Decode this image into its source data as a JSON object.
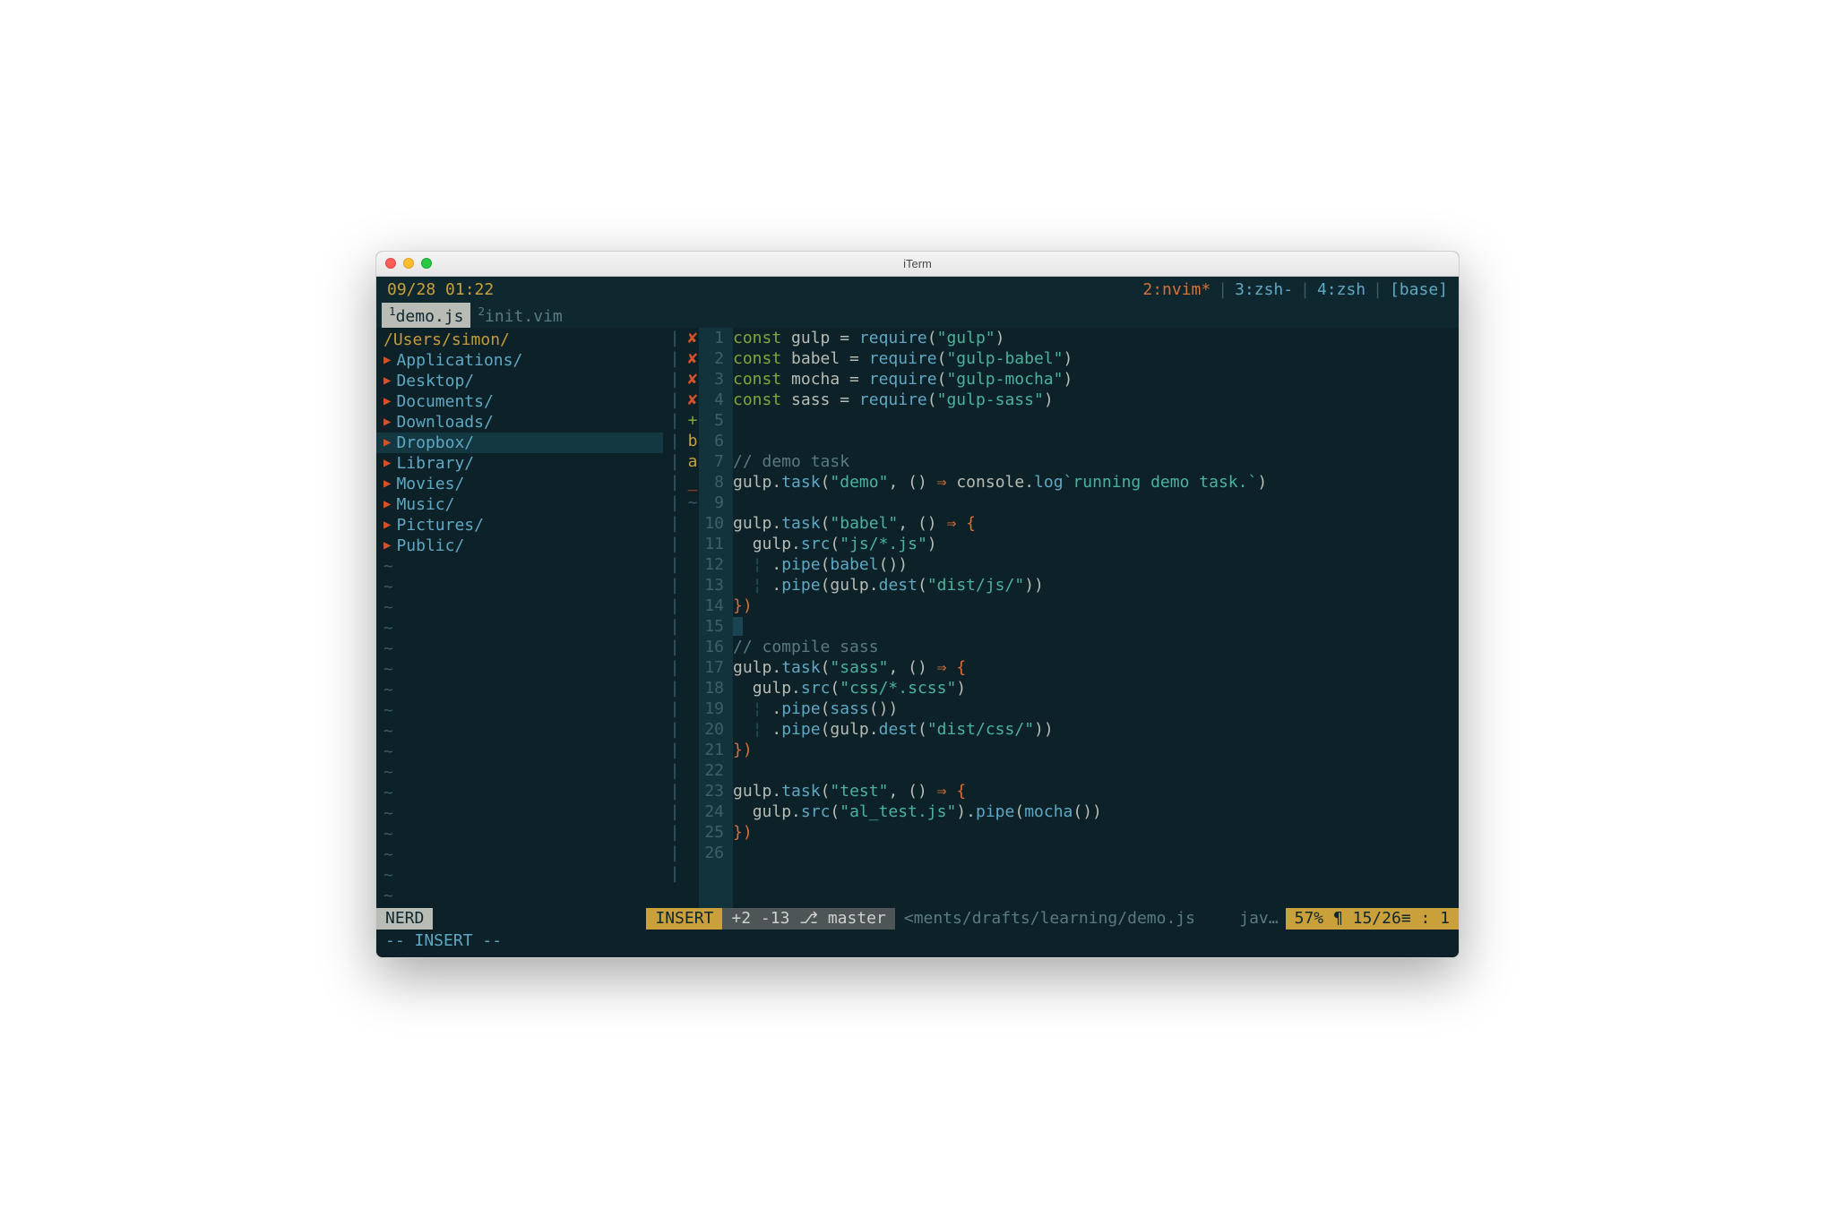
{
  "window": {
    "title": "iTerm"
  },
  "topbar": {
    "time": "09/28 01:22",
    "tabs": {
      "nvim": "2:nvim*",
      "zsh3": "3:zsh-",
      "zsh4": "4:zsh",
      "base": "[base]"
    }
  },
  "tabbar": {
    "active": {
      "num": "1",
      "name": "demo.js"
    },
    "inactive": {
      "num": "2",
      "name": "init.vim"
    }
  },
  "tree": {
    "path": "/Users/simon/",
    "items": [
      "Applications/",
      "Desktop/",
      "Documents/",
      "Downloads/",
      "Dropbox/",
      "Library/",
      "Movies/",
      "Music/",
      "Pictures/",
      "Public/"
    ],
    "selected_index": 4,
    "tildes": 17
  },
  "signs": [
    "✘",
    "✘",
    "✘",
    "✘",
    "",
    "",
    "+",
    "",
    "b",
    "",
    "",
    "",
    "",
    "",
    "",
    "a",
    "",
    "",
    "",
    "",
    "",
    "",
    "",
    "",
    "",
    "_"
  ],
  "linenums": 26,
  "code": [
    [
      [
        "kw",
        "const "
      ],
      [
        "ident",
        "gulp"
      ],
      [
        "op",
        " = "
      ],
      [
        "func",
        "require"
      ],
      [
        "paren",
        "("
      ],
      [
        "str",
        "\"gulp\""
      ],
      [
        "paren",
        ")"
      ]
    ],
    [
      [
        "kw",
        "const "
      ],
      [
        "ident",
        "babel"
      ],
      [
        "op",
        " = "
      ],
      [
        "func",
        "require"
      ],
      [
        "paren",
        "("
      ],
      [
        "str",
        "\"gulp-babel\""
      ],
      [
        "paren",
        ")"
      ]
    ],
    [
      [
        "kw",
        "const "
      ],
      [
        "ident",
        "mocha"
      ],
      [
        "op",
        " = "
      ],
      [
        "func",
        "require"
      ],
      [
        "paren",
        "("
      ],
      [
        "str",
        "\"gulp-mocha\""
      ],
      [
        "paren",
        ")"
      ]
    ],
    [
      [
        "kw",
        "const "
      ],
      [
        "ident",
        "sass"
      ],
      [
        "op",
        " = "
      ],
      [
        "func",
        "require"
      ],
      [
        "paren",
        "("
      ],
      [
        "str",
        "\"gulp-sass\""
      ],
      [
        "paren",
        ")"
      ]
    ],
    [],
    [],
    [
      [
        "comment",
        "// demo task"
      ]
    ],
    [
      [
        "ident",
        "gulp"
      ],
      [
        "dot",
        "."
      ],
      [
        "prop",
        "task"
      ],
      [
        "paren",
        "("
      ],
      [
        "str",
        "\"demo\""
      ],
      [
        "op",
        ", "
      ],
      [
        "paren",
        "()"
      ],
      [
        "op",
        " "
      ],
      [
        "arrow",
        "⇒"
      ],
      [
        "op",
        " "
      ],
      [
        "ident",
        "console"
      ],
      [
        "dot",
        "."
      ],
      [
        "prop",
        "log"
      ],
      [
        "tmpl",
        "`running demo task.`"
      ],
      [
        "paren",
        ")"
      ]
    ],
    [],
    [
      [
        "ident",
        "gulp"
      ],
      [
        "dot",
        "."
      ],
      [
        "prop",
        "task"
      ],
      [
        "paren",
        "("
      ],
      [
        "str",
        "\"babel\""
      ],
      [
        "op",
        ", "
      ],
      [
        "paren",
        "()"
      ],
      [
        "op",
        " "
      ],
      [
        "arrow",
        "⇒"
      ],
      [
        "op",
        " "
      ],
      [
        "brace",
        "{"
      ]
    ],
    [
      [
        "op",
        "  "
      ],
      [
        "ident",
        "gulp"
      ],
      [
        "dot",
        "."
      ],
      [
        "prop",
        "src"
      ],
      [
        "paren",
        "("
      ],
      [
        "str",
        "\"js/*.js\""
      ],
      [
        "paren",
        ")"
      ]
    ],
    [
      [
        "op",
        "  "
      ],
      [
        "guide",
        "¦ "
      ],
      [
        "dot",
        "."
      ],
      [
        "prop",
        "pipe"
      ],
      [
        "paren",
        "("
      ],
      [
        "func",
        "babel"
      ],
      [
        "paren",
        "())"
      ]
    ],
    [
      [
        "op",
        "  "
      ],
      [
        "guide",
        "¦ "
      ],
      [
        "dot",
        "."
      ],
      [
        "prop",
        "pipe"
      ],
      [
        "paren",
        "("
      ],
      [
        "ident",
        "gulp"
      ],
      [
        "dot",
        "."
      ],
      [
        "prop",
        "dest"
      ],
      [
        "paren",
        "("
      ],
      [
        "str",
        "\"dist/js/\""
      ],
      [
        "paren",
        "))"
      ]
    ],
    [
      [
        "brace",
        "})"
      ]
    ],
    [
      [
        "cursor",
        " "
      ]
    ],
    [
      [
        "comment",
        "// compile sass"
      ]
    ],
    [
      [
        "ident",
        "gulp"
      ],
      [
        "dot",
        "."
      ],
      [
        "prop",
        "task"
      ],
      [
        "paren",
        "("
      ],
      [
        "str",
        "\"sass\""
      ],
      [
        "op",
        ", "
      ],
      [
        "paren",
        "()"
      ],
      [
        "op",
        " "
      ],
      [
        "arrow",
        "⇒"
      ],
      [
        "op",
        " "
      ],
      [
        "brace",
        "{"
      ]
    ],
    [
      [
        "op",
        "  "
      ],
      [
        "ident",
        "gulp"
      ],
      [
        "dot",
        "."
      ],
      [
        "prop",
        "src"
      ],
      [
        "paren",
        "("
      ],
      [
        "str",
        "\"css/*.scss\""
      ],
      [
        "paren",
        ")"
      ]
    ],
    [
      [
        "op",
        "  "
      ],
      [
        "guide",
        "¦ "
      ],
      [
        "dot",
        "."
      ],
      [
        "prop",
        "pipe"
      ],
      [
        "paren",
        "("
      ],
      [
        "func",
        "sass"
      ],
      [
        "paren",
        "())"
      ]
    ],
    [
      [
        "op",
        "  "
      ],
      [
        "guide",
        "¦ "
      ],
      [
        "dot",
        "."
      ],
      [
        "prop",
        "pipe"
      ],
      [
        "paren",
        "("
      ],
      [
        "ident",
        "gulp"
      ],
      [
        "dot",
        "."
      ],
      [
        "prop",
        "dest"
      ],
      [
        "paren",
        "("
      ],
      [
        "str",
        "\"dist/css/\""
      ],
      [
        "paren",
        "))"
      ]
    ],
    [
      [
        "brace",
        "})"
      ]
    ],
    [],
    [
      [
        "ident",
        "gulp"
      ],
      [
        "dot",
        "."
      ],
      [
        "prop",
        "task"
      ],
      [
        "paren",
        "("
      ],
      [
        "str",
        "\"test\""
      ],
      [
        "op",
        ", "
      ],
      [
        "paren",
        "()"
      ],
      [
        "op",
        " "
      ],
      [
        "arrow",
        "⇒"
      ],
      [
        "op",
        " "
      ],
      [
        "brace",
        "{"
      ]
    ],
    [
      [
        "op",
        "  "
      ],
      [
        "ident",
        "gulp"
      ],
      [
        "dot",
        "."
      ],
      [
        "prop",
        "src"
      ],
      [
        "paren",
        "("
      ],
      [
        "str",
        "\"al_test.js\""
      ],
      [
        "paren",
        ")"
      ],
      [
        "dot",
        "."
      ],
      [
        "prop",
        "pipe"
      ],
      [
        "paren",
        "("
      ],
      [
        "func",
        "mocha"
      ],
      [
        "paren",
        "())"
      ]
    ],
    [
      [
        "brace",
        "})"
      ]
    ],
    []
  ],
  "statusbar": {
    "nerd": "NERD",
    "insert": "INSERT",
    "git": "+2 -13 ⎇ master",
    "path": "<ments/drafts/learning/demo.js",
    "lang": "jav…",
    "pos": "57% ¶  15/26≡ :  1"
  },
  "bottomline": "-- INSERT --"
}
